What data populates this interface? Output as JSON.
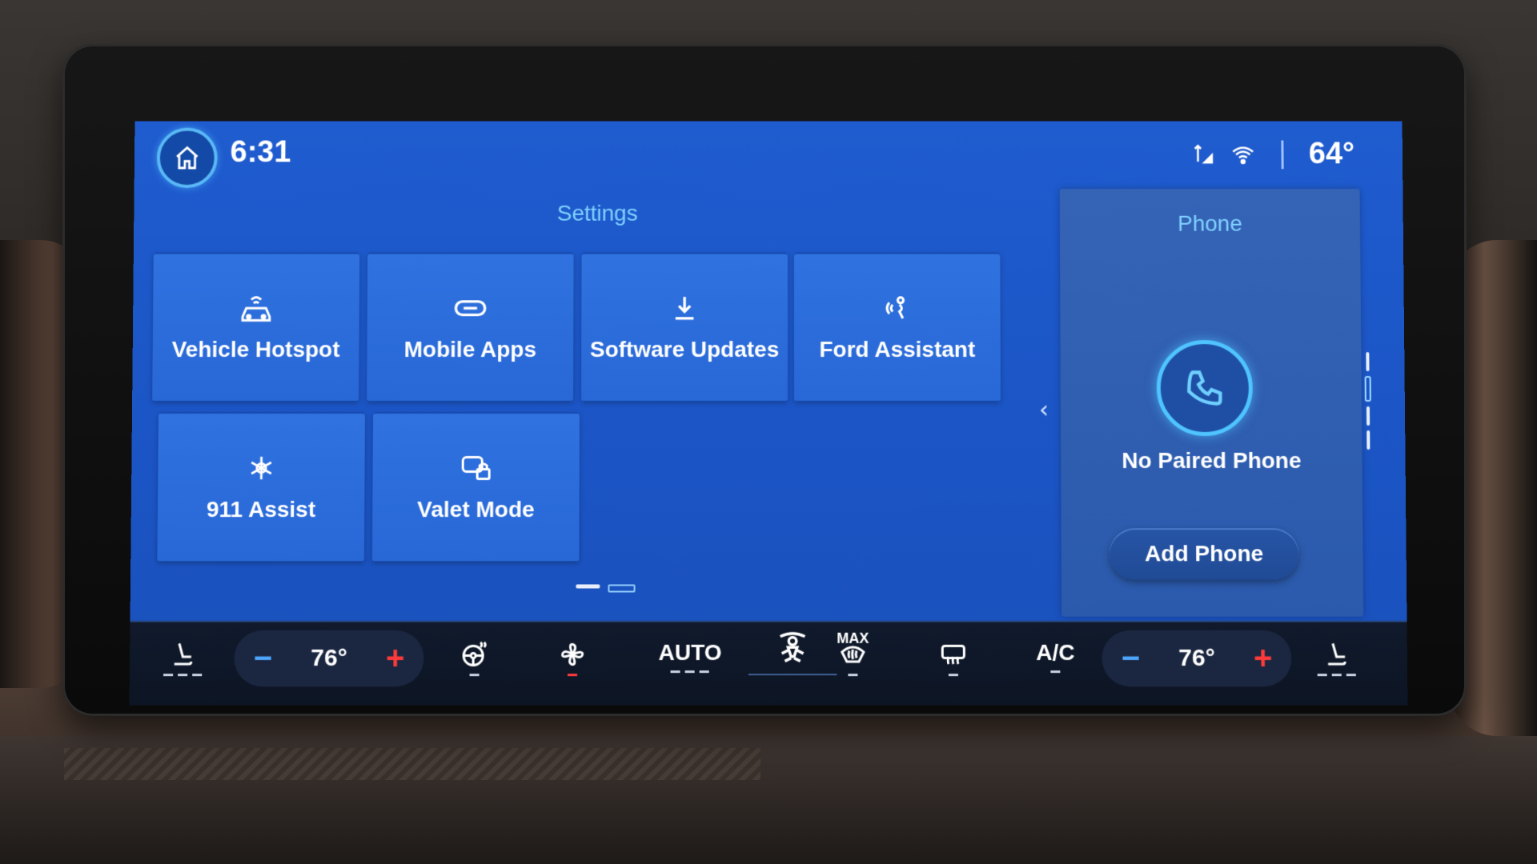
{
  "status_bar": {
    "clock": "6:31",
    "outside_temp": "64°"
  },
  "settings": {
    "title": "Settings",
    "tiles": [
      {
        "label": "Vehicle Hotspot",
        "icon": "car-wifi-icon"
      },
      {
        "label": "Mobile Apps",
        "icon": "link-icon"
      },
      {
        "label": "Software Updates",
        "icon": "download-icon"
      },
      {
        "label": "Ford Assistant",
        "icon": "voice-assistant-icon"
      },
      {
        "label": "911 Assist",
        "icon": "star-of-life-icon"
      },
      {
        "label": "Valet Mode",
        "icon": "valet-lock-icon"
      }
    ]
  },
  "phone": {
    "title": "Phone",
    "status": "No Paired Phone",
    "add_button": "Add Phone"
  },
  "climate": {
    "driver_temp": "76°",
    "passenger_temp": "76°",
    "minus": "−",
    "plus": "+",
    "auto_label": "AUTO",
    "max_label": "MAX",
    "ac_label": "A/C"
  },
  "colors": {
    "screen_bg": "#1f5ccf",
    "accent": "#7fd1ff",
    "tile": "#2f72e0",
    "climate_bar": "#101a2c",
    "plus_red": "#ff3a3a",
    "minus_blue": "#4ea8ff"
  }
}
